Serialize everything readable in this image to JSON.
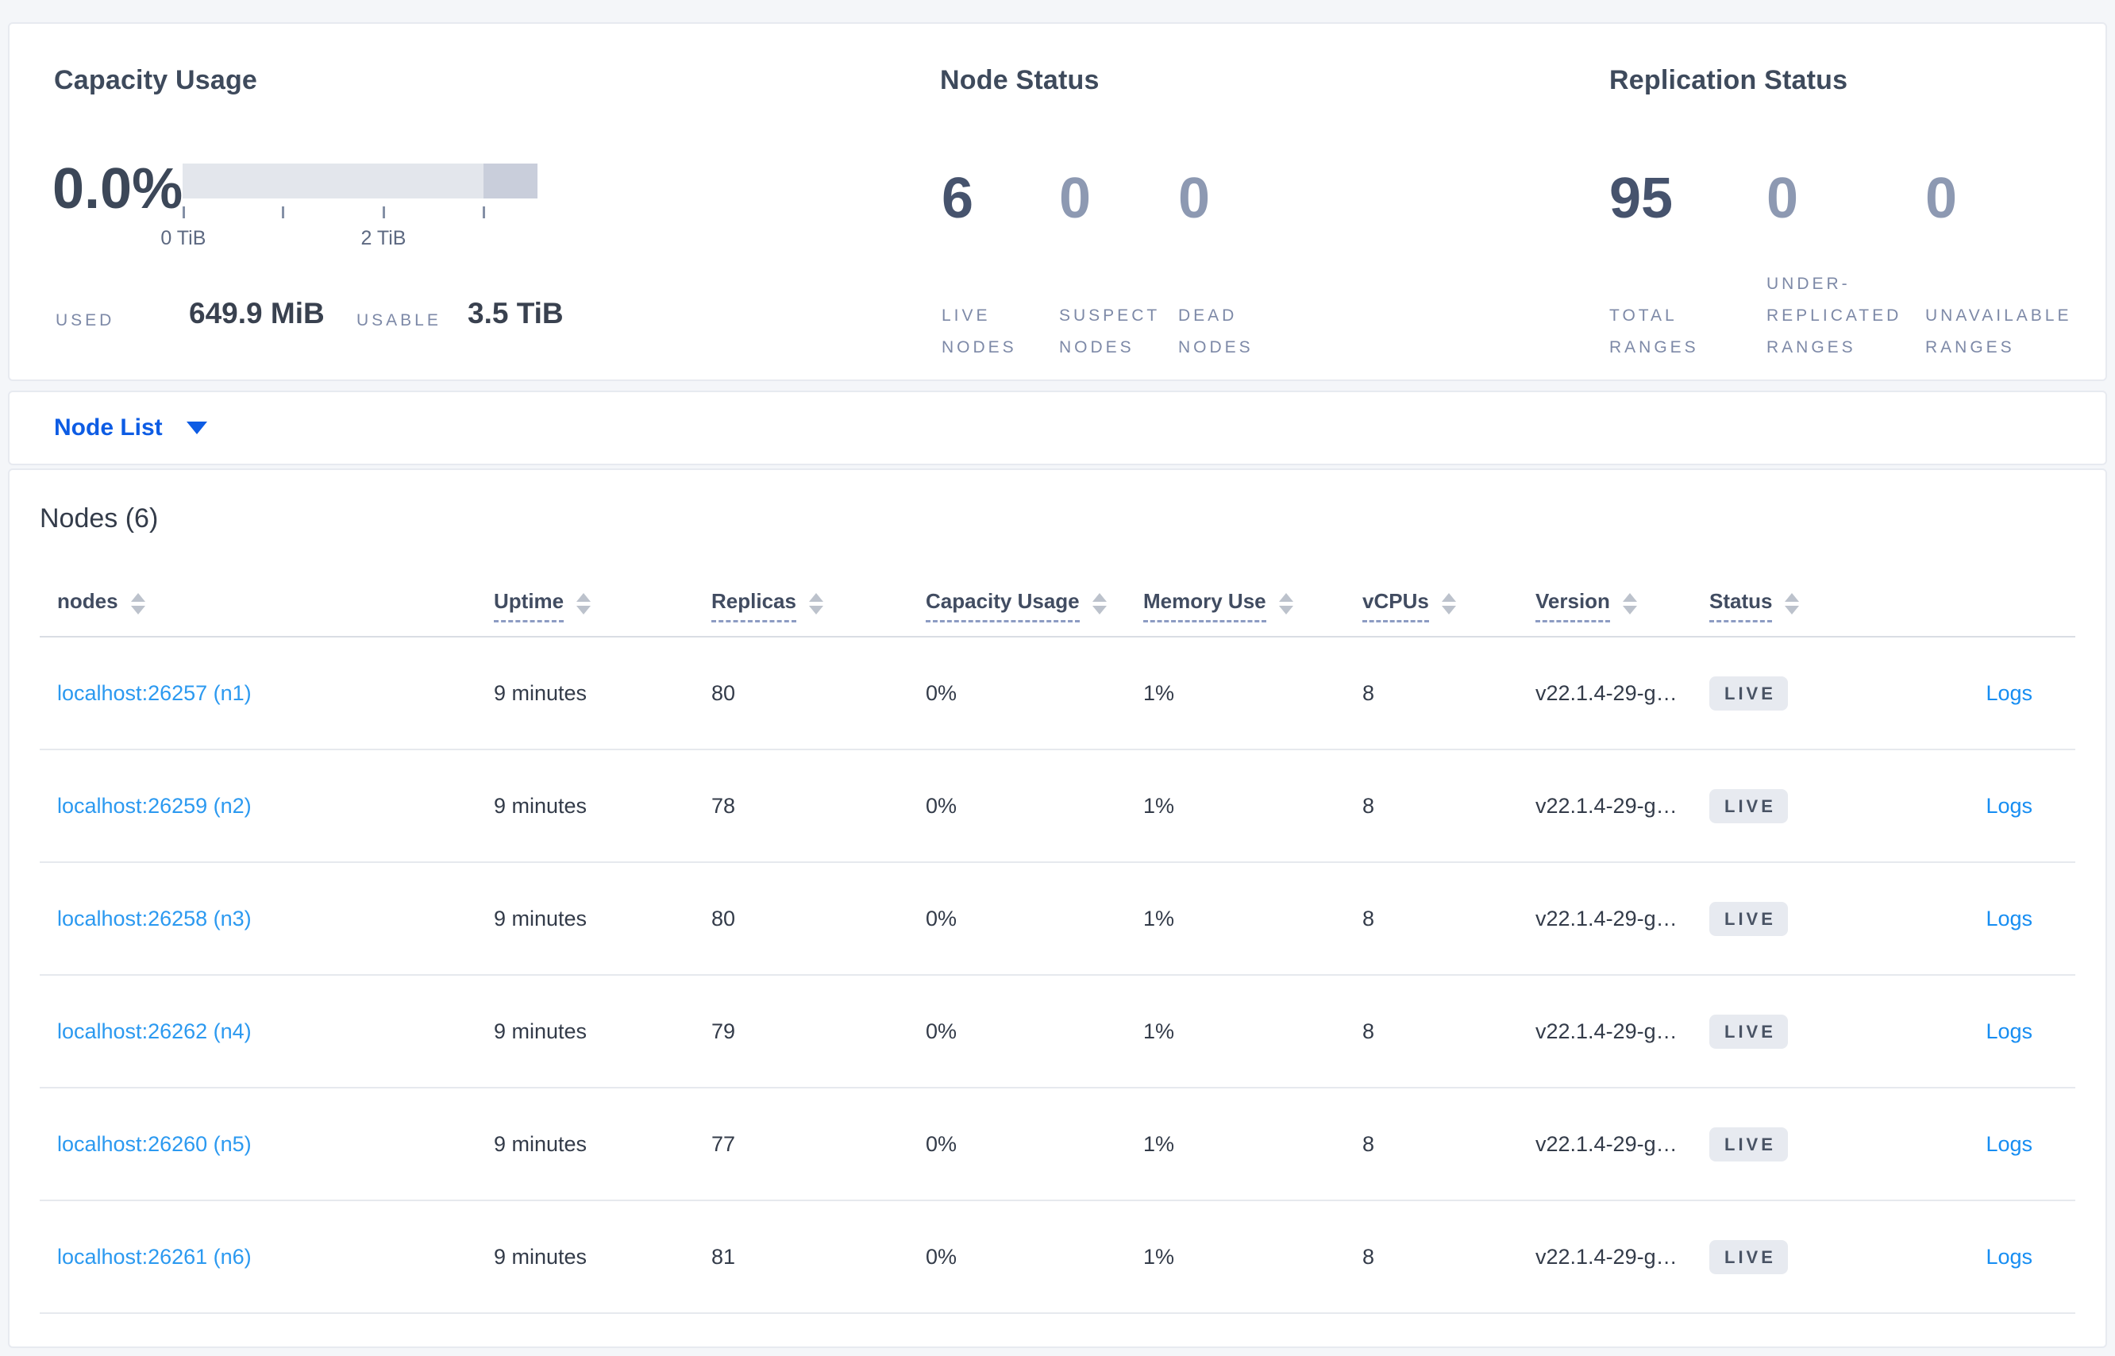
{
  "summary": {
    "capacity": {
      "title": "Capacity Usage",
      "percent": "0.0%",
      "used_label": "USED",
      "used_value": "649.9 MiB",
      "usable_label": "USABLE",
      "usable_value": "3.5 TiB",
      "bar": {
        "used_pct": 0,
        "dark_segment_from_pct": 84.8
      },
      "ticks": [
        {
          "pos_pct": 0.2,
          "label": "0 TiB"
        },
        {
          "pos_pct": 28.2,
          "label": ""
        },
        {
          "pos_pct": 56.6,
          "label": "2 TiB"
        },
        {
          "pos_pct": 84.8,
          "label": ""
        }
      ]
    },
    "node_status": {
      "title": "Node Status",
      "metrics": [
        {
          "value": "6",
          "label_lines": [
            "LIVE",
            "NODES"
          ],
          "emphasis": true
        },
        {
          "value": "0",
          "label_lines": [
            "SUSPECT",
            "NODES"
          ],
          "emphasis": false
        },
        {
          "value": "0",
          "label_lines": [
            "DEAD",
            "NODES"
          ],
          "emphasis": false
        }
      ]
    },
    "replication_status": {
      "title": "Replication Status",
      "metrics": [
        {
          "value": "95",
          "label_lines": [
            "TOTAL",
            "RANGES"
          ],
          "emphasis": true
        },
        {
          "value": "0",
          "label_lines": [
            "UNDER-",
            "REPLICATED",
            "RANGES"
          ],
          "emphasis": false
        },
        {
          "value": "0",
          "label_lines": [
            "UNAVAILABLE",
            "RANGES"
          ],
          "emphasis": false
        }
      ]
    }
  },
  "view_selector": {
    "label": "Node List"
  },
  "nodes_section": {
    "title": "Nodes (6)",
    "columns": [
      {
        "key": "node",
        "label": "nodes",
        "sortable": true,
        "underlined": false
      },
      {
        "key": "uptime",
        "label": "Uptime",
        "sortable": true,
        "underlined": true
      },
      {
        "key": "replicas",
        "label": "Replicas",
        "sortable": true,
        "underlined": true
      },
      {
        "key": "capacity",
        "label": "Capacity Usage",
        "sortable": true,
        "underlined": true
      },
      {
        "key": "memory",
        "label": "Memory Use",
        "sortable": true,
        "underlined": true
      },
      {
        "key": "vcpus",
        "label": "vCPUs",
        "sortable": true,
        "underlined": true
      },
      {
        "key": "version",
        "label": "Version",
        "sortable": true,
        "underlined": true
      },
      {
        "key": "status",
        "label": "Status",
        "sortable": true,
        "underlined": true
      },
      {
        "key": "logs",
        "label": "",
        "sortable": false,
        "underlined": false
      }
    ],
    "rows": [
      {
        "node": "localhost:26257 (n1)",
        "uptime": "9 minutes",
        "replicas": "80",
        "capacity": "0%",
        "memory": "1%",
        "vcpus": "8",
        "version": "v22.1.4-29-g…",
        "status": "LIVE",
        "logs": "Logs"
      },
      {
        "node": "localhost:26259 (n2)",
        "uptime": "9 minutes",
        "replicas": "78",
        "capacity": "0%",
        "memory": "1%",
        "vcpus": "8",
        "version": "v22.1.4-29-g…",
        "status": "LIVE",
        "logs": "Logs"
      },
      {
        "node": "localhost:26258 (n3)",
        "uptime": "9 minutes",
        "replicas": "80",
        "capacity": "0%",
        "memory": "1%",
        "vcpus": "8",
        "version": "v22.1.4-29-g…",
        "status": "LIVE",
        "logs": "Logs"
      },
      {
        "node": "localhost:26262 (n4)",
        "uptime": "9 minutes",
        "replicas": "79",
        "capacity": "0%",
        "memory": "1%",
        "vcpus": "8",
        "version": "v22.1.4-29-g…",
        "status": "LIVE",
        "logs": "Logs"
      },
      {
        "node": "localhost:26260 (n5)",
        "uptime": "9 minutes",
        "replicas": "77",
        "capacity": "0%",
        "memory": "1%",
        "vcpus": "8",
        "version": "v22.1.4-29-g…",
        "status": "LIVE",
        "logs": "Logs"
      },
      {
        "node": "localhost:26261 (n6)",
        "uptime": "9 minutes",
        "replicas": "81",
        "capacity": "0%",
        "memory": "1%",
        "vcpus": "8",
        "version": "v22.1.4-29-g…",
        "status": "LIVE",
        "logs": "Logs"
      }
    ]
  },
  "colors": {
    "page_background": "#f4f6f9",
    "panel_background": "#ffffff",
    "accent_blue": "#0d5ce4",
    "node_link_blue": "#2b99f0",
    "logs_link_blue": "#168df2",
    "bar_light_gray": "#e3e6ec",
    "bar_dark_gray": "#c9cedb",
    "status_badge_background": "#e7eaf0",
    "status_badge_text": "#495364",
    "emphasis_number": "#46536d",
    "muted_number": "#8d99b2",
    "label_gray_blue": "#7d89a7"
  }
}
